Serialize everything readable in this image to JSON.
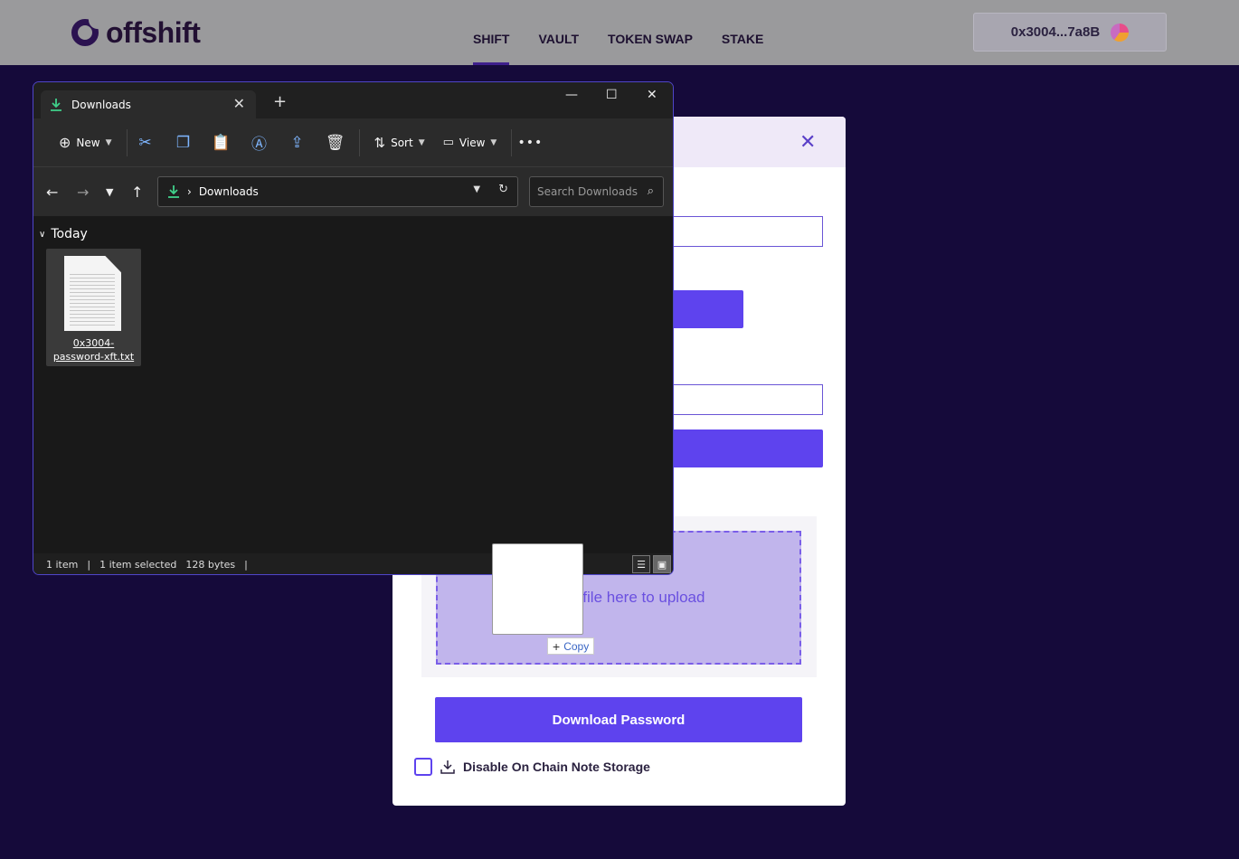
{
  "brand": {
    "name": "offshift"
  },
  "nav": [
    {
      "label": "SHIFT",
      "active": true
    },
    {
      "label": "VAULT"
    },
    {
      "label": "TOKEN SWAP"
    },
    {
      "label": "STAKE"
    }
  ],
  "wallet": {
    "address": "0x3004...7a8B"
  },
  "modal": {
    "close_icon": "✕",
    "dropzone_text": "Drop a file here to upload",
    "download_button": "Download Password",
    "checkbox_label": "Disable On Chain Note Storage",
    "accent_color": "#5e43ee"
  },
  "drag": {
    "copy_label": "Copy"
  },
  "explorer": {
    "tab_title": "Downloads",
    "toolbar": {
      "new_label": "New",
      "sort_label": "Sort",
      "view_label": "View"
    },
    "address": {
      "folder": "Downloads"
    },
    "search_placeholder": "Search Downloads",
    "group": "Today",
    "file": {
      "name": "0x3004-password-xft.txt"
    },
    "status": {
      "count": "1 item",
      "selected": "1 item selected",
      "size": "128 bytes"
    }
  }
}
